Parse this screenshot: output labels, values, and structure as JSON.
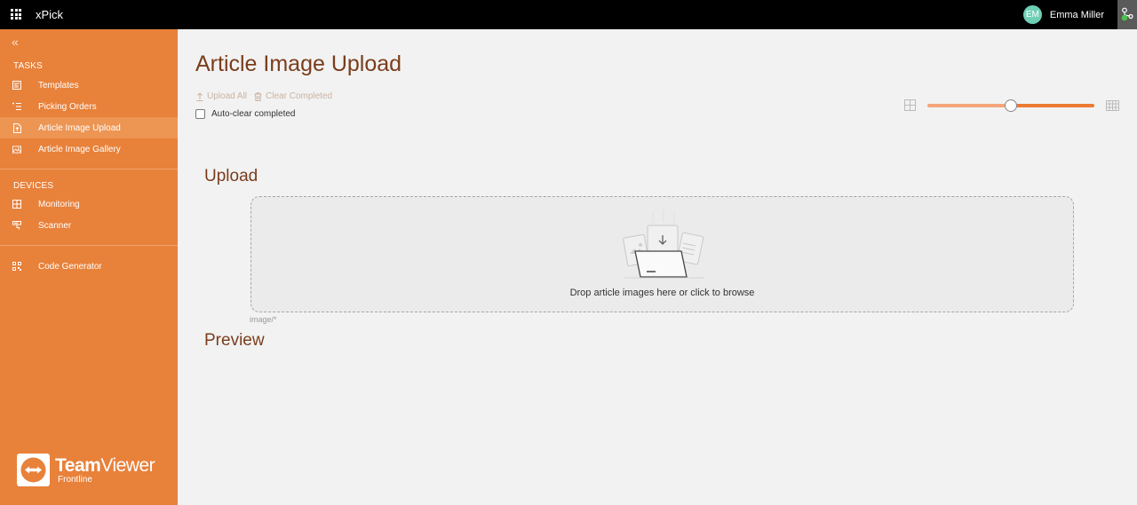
{
  "header": {
    "app_icon": "apps-grid-icon",
    "app_title": "xPick",
    "user": {
      "initials": "EM",
      "name": "Emma Miller",
      "avatar_color": "#6fcfb5"
    },
    "status_icon": "connection-status-icon"
  },
  "sidebar": {
    "collapse_icon": "double-chevron-left-icon",
    "sections": [
      {
        "title": "TASKS",
        "items": [
          {
            "label": "Templates",
            "icon": "template-icon",
            "active": false
          },
          {
            "label": "Picking Orders",
            "icon": "list-icon",
            "active": false
          },
          {
            "label": "Article Image Upload",
            "icon": "file-upload-icon",
            "active": true
          },
          {
            "label": "Article Image Gallery",
            "icon": "image-icon",
            "active": false
          }
        ]
      },
      {
        "title": "DEVICES",
        "items": [
          {
            "label": "Monitoring",
            "icon": "grid-icon",
            "active": false
          },
          {
            "label": "Scanner",
            "icon": "scanner-icon",
            "active": false
          }
        ]
      },
      {
        "title": "",
        "items": [
          {
            "label": "Code Generator",
            "icon": "qr-code-icon",
            "active": false
          }
        ]
      }
    ],
    "brand": {
      "name_bold": "Team",
      "name_light": "Viewer",
      "sub": "Frontline"
    },
    "colors": {
      "background": "#e8813a",
      "active": "#ed9553"
    }
  },
  "main": {
    "title": "Article Image Upload",
    "toolbar": {
      "upload_all": "Upload All",
      "clear_completed": "Clear Completed"
    },
    "auto_clear": {
      "label": "Auto-clear completed",
      "checked": false
    },
    "thumbnail_size": {
      "value_percent": 50
    },
    "upload_section": {
      "title": "Upload",
      "dropzone_text": "Drop article images here or click to browse",
      "accept": "image/*"
    },
    "preview_section": {
      "title": "Preview"
    },
    "accent_color": "#ec7a32",
    "heading_color": "#7a3d1c"
  }
}
